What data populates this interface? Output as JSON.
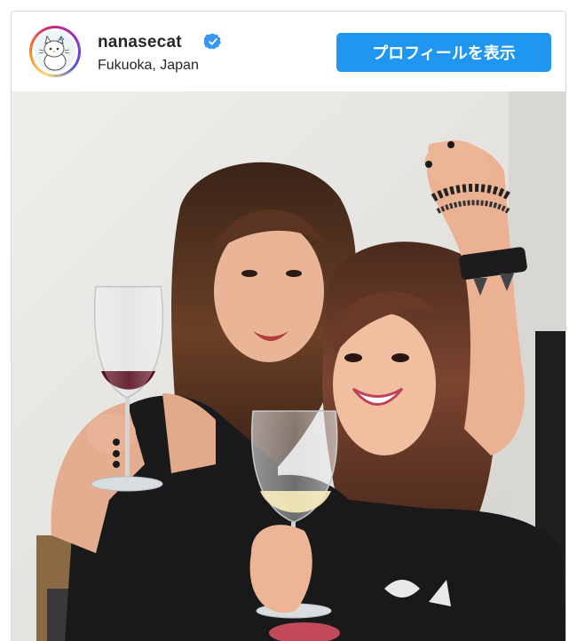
{
  "post": {
    "username": "nanasecat",
    "location": "Fukuoka, Japan",
    "verified": true,
    "profile_button_label": "プロフィールを表示",
    "avatar_icon": "cat-avatar-icon",
    "verified_icon": "verified-badge-icon"
  },
  "colors": {
    "button": "#1f97f0",
    "verified": "#3897f0",
    "text": "#262626",
    "border": "#dbdbdb"
  }
}
